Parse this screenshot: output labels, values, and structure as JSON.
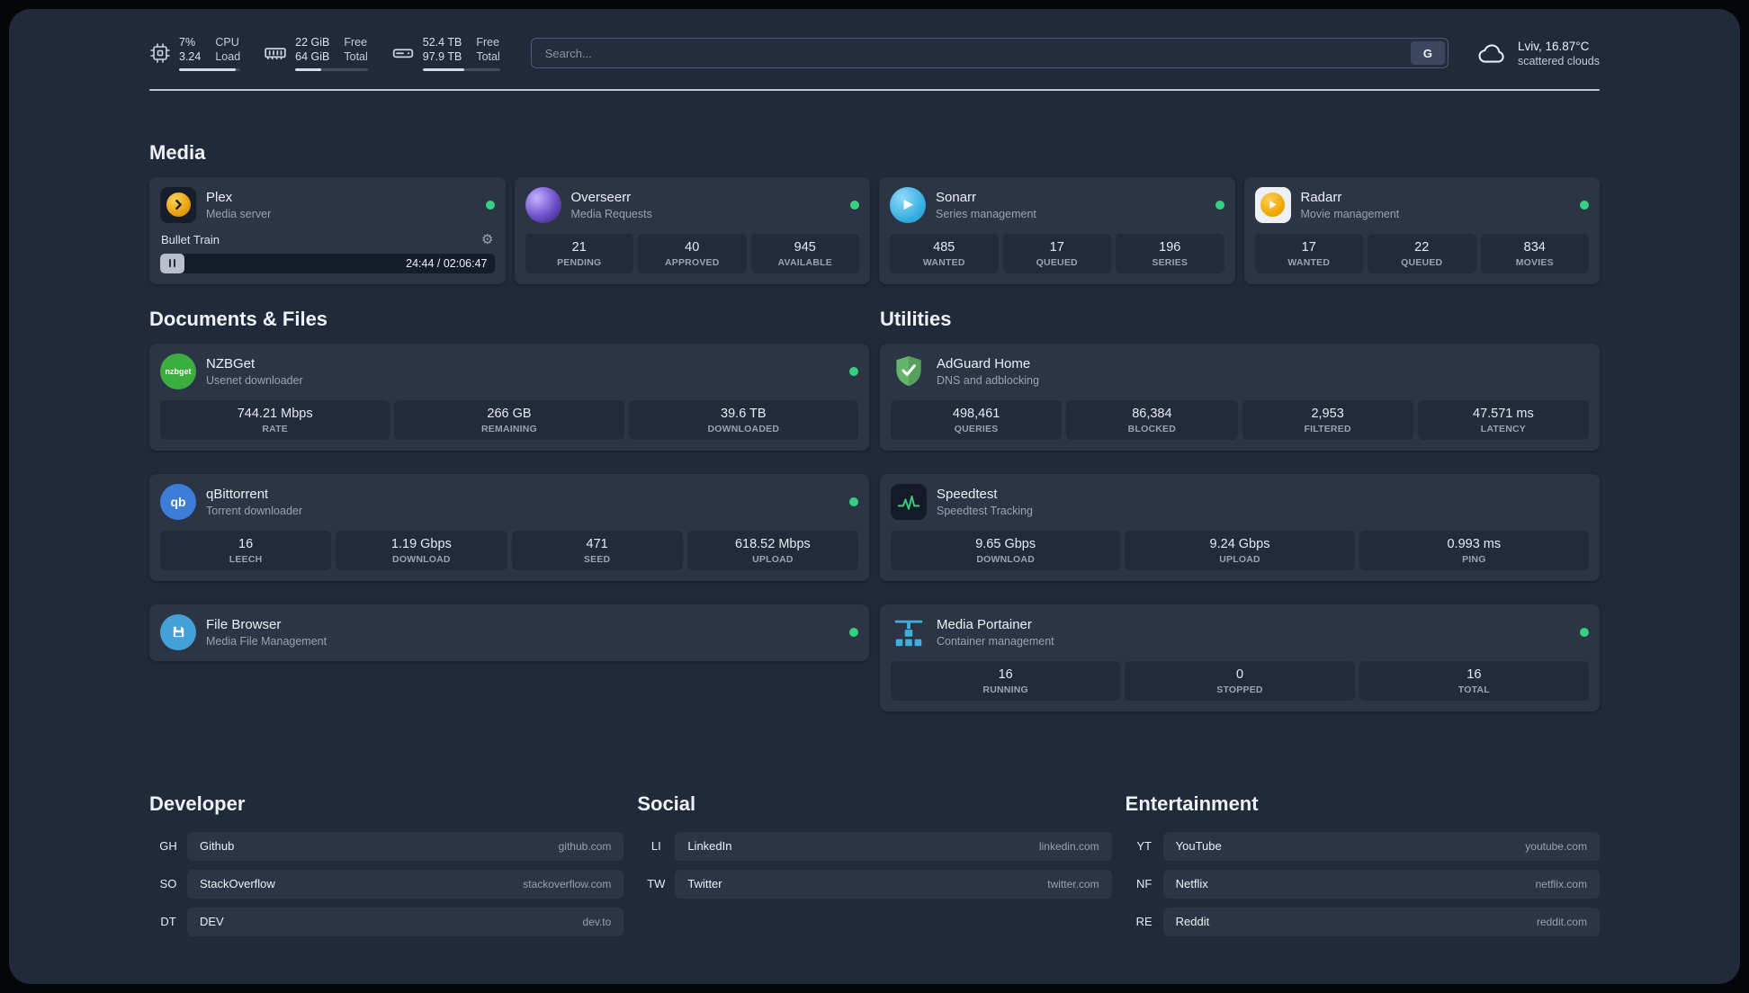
{
  "theme": {
    "page_bg": "#202a3a",
    "card_bg": "#2b3545",
    "tile_bg": "#222b39",
    "status_green": "#35d07f",
    "text_primary": "#eef1f6",
    "text_muted": "#98a2b3",
    "divider": "#dfe3ea"
  },
  "header": {
    "cpu": {
      "value_top": "7%",
      "value_bottom": "3.24",
      "label_top": "CPU",
      "label_bottom": "Load",
      "bar": "93%"
    },
    "memory": {
      "value_top": "22 GiB",
      "value_bottom": "64 GiB",
      "label_top": "Free",
      "label_bottom": "Total",
      "bar": "36%"
    },
    "disk": {
      "value_top": "52.4 TB",
      "value_bottom": "97.9 TB",
      "label_top": "Free",
      "label_bottom": "Total",
      "bar": "54%"
    },
    "search": {
      "placeholder": "Search...",
      "button": "G"
    },
    "weather": {
      "location": "Lviv, 16.87°C",
      "condition": "scattered clouds"
    }
  },
  "sections": {
    "media": {
      "title": "Media"
    },
    "documents": {
      "title": "Documents & Files"
    },
    "utilities": {
      "title": "Utilities"
    },
    "developer": {
      "title": "Developer"
    },
    "social": {
      "title": "Social"
    },
    "entertainment": {
      "title": "Entertainment"
    }
  },
  "services": {
    "plex": {
      "name": "Plex",
      "desc": "Media server",
      "now_playing": "Bullet Train",
      "time": "24:44 / 02:06:47"
    },
    "overseerr": {
      "name": "Overseerr",
      "desc": "Media Requests",
      "stats": [
        {
          "value": "21",
          "label": "PENDING"
        },
        {
          "value": "40",
          "label": "APPROVED"
        },
        {
          "value": "945",
          "label": "AVAILABLE"
        }
      ]
    },
    "sonarr": {
      "name": "Sonarr",
      "desc": "Series management",
      "stats": [
        {
          "value": "485",
          "label": "WANTED"
        },
        {
          "value": "17",
          "label": "QUEUED"
        },
        {
          "value": "196",
          "label": "SERIES"
        }
      ]
    },
    "radarr": {
      "name": "Radarr",
      "desc": "Movie management",
      "stats": [
        {
          "value": "17",
          "label": "WANTED"
        },
        {
          "value": "22",
          "label": "QUEUED"
        },
        {
          "value": "834",
          "label": "MOVIES"
        }
      ]
    },
    "nzbget": {
      "name": "NZBGet",
      "desc": "Usenet downloader",
      "icon_text": "nzbget",
      "stats": [
        {
          "value": "744.21 Mbps",
          "label": "RATE"
        },
        {
          "value": "266 GB",
          "label": "REMAINING"
        },
        {
          "value": "39.6 TB",
          "label": "DOWNLOADED"
        }
      ]
    },
    "qbittorrent": {
      "name": "qBittorrent",
      "desc": "Torrent downloader",
      "icon_text": "qb",
      "stats": [
        {
          "value": "16",
          "label": "LEECH"
        },
        {
          "value": "1.19 Gbps",
          "label": "DOWNLOAD"
        },
        {
          "value": "471",
          "label": "SEED"
        },
        {
          "value": "618.52 Mbps",
          "label": "UPLOAD"
        }
      ]
    },
    "filebrowser": {
      "name": "File Browser",
      "desc": "Media File Management"
    },
    "adguard": {
      "name": "AdGuard Home",
      "desc": "DNS and adblocking",
      "stats": [
        {
          "value": "498,461",
          "label": "QUERIES"
        },
        {
          "value": "86,384",
          "label": "BLOCKED"
        },
        {
          "value": "2,953",
          "label": "FILTERED"
        },
        {
          "value": "47.571 ms",
          "label": "LATENCY"
        }
      ]
    },
    "speedtest": {
      "name": "Speedtest",
      "desc": "Speedtest Tracking",
      "stats": [
        {
          "value": "9.65 Gbps",
          "label": "DOWNLOAD"
        },
        {
          "value": "9.24 Gbps",
          "label": "UPLOAD"
        },
        {
          "value": "0.993 ms",
          "label": "PING"
        }
      ]
    },
    "portainer": {
      "name": "Media Portainer",
      "desc": "Container management",
      "stats": [
        {
          "value": "16",
          "label": "RUNNING"
        },
        {
          "value": "0",
          "label": "STOPPED"
        },
        {
          "value": "16",
          "label": "TOTAL"
        }
      ]
    }
  },
  "bookmarks": {
    "developer": [
      {
        "abbr": "GH",
        "name": "Github",
        "domain": "github.com"
      },
      {
        "abbr": "SO",
        "name": "StackOverflow",
        "domain": "stackoverflow.com"
      },
      {
        "abbr": "DT",
        "name": "DEV",
        "domain": "dev.to"
      }
    ],
    "social": [
      {
        "abbr": "LI",
        "name": "LinkedIn",
        "domain": "linkedin.com"
      },
      {
        "abbr": "TW",
        "name": "Twitter",
        "domain": "twitter.com"
      }
    ],
    "entertainment": [
      {
        "abbr": "YT",
        "name": "YouTube",
        "domain": "youtube.com"
      },
      {
        "abbr": "NF",
        "name": "Netflix",
        "domain": "netflix.com"
      },
      {
        "abbr": "RE",
        "name": "Reddit",
        "domain": "reddit.com"
      }
    ]
  }
}
